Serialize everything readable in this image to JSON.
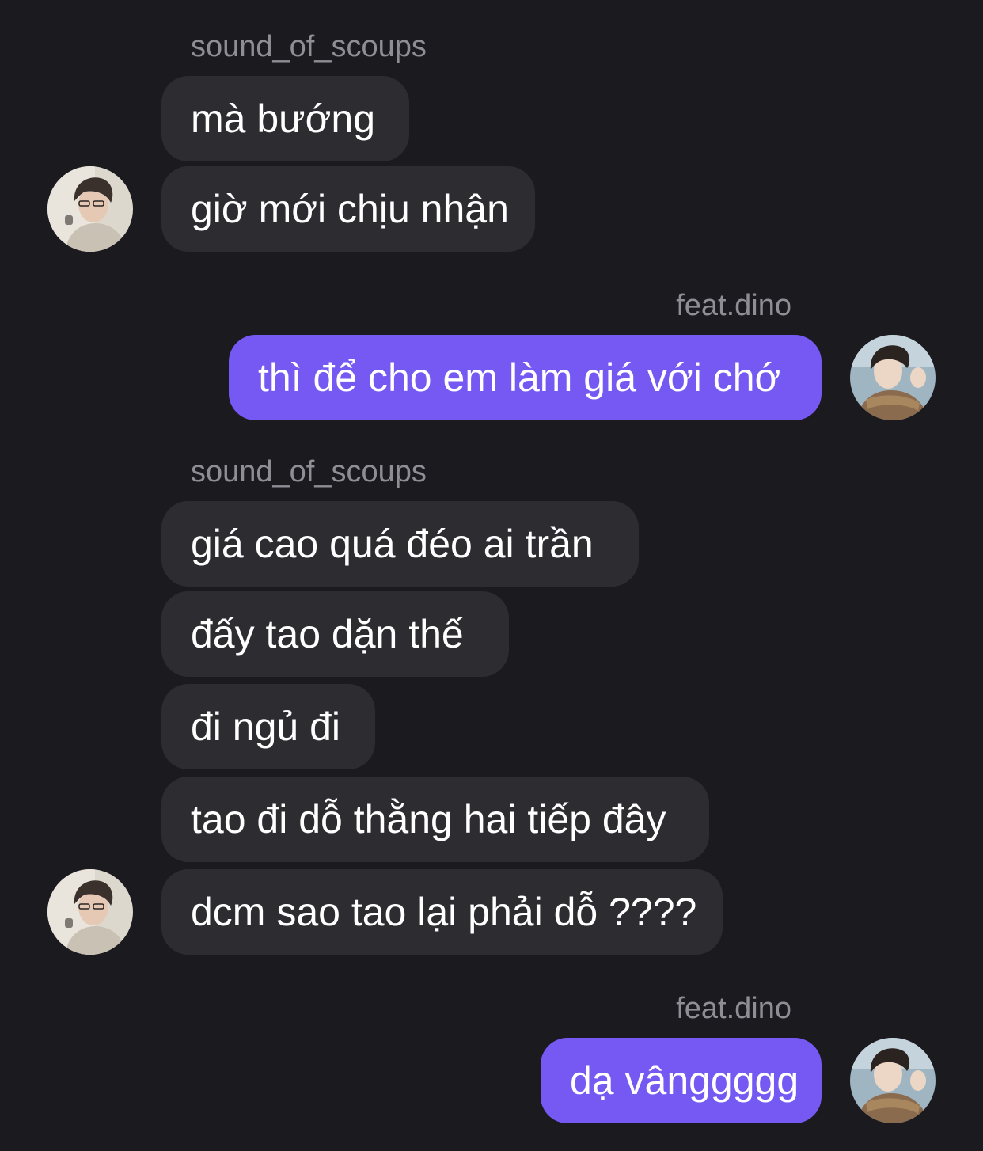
{
  "conversation": [
    {
      "sender": "sound_of_scoups",
      "direction": "incoming",
      "messages": [
        "mà bướng",
        "giờ mới chịu nhận"
      ]
    },
    {
      "sender": "feat.dino",
      "direction": "outgoing",
      "messages": [
        "thì để cho em làm giá với chớ"
      ]
    },
    {
      "sender": "sound_of_scoups",
      "direction": "incoming",
      "messages": [
        "giá cao quá đéo ai trần",
        "đấy tao dặn thế",
        "đi ngủ đi",
        "tao đi dỗ thằng hai tiếp đây",
        "dcm sao tao lại phải dỗ ????"
      ]
    },
    {
      "sender": "feat.dino",
      "direction": "outgoing",
      "messages": [
        "dạ vânggggg"
      ]
    }
  ],
  "colors": {
    "background": "#1b1a1f",
    "incoming_bubble": "#2d2c31",
    "outgoing_bubble": "#7659f2",
    "sender_name": "#8f8e94",
    "message_text": "#ffffff"
  },
  "icons": {
    "incoming_avatar": "avatar-sound-of-scoups-icon",
    "outgoing_avatar": "avatar-feat-dino-icon"
  }
}
